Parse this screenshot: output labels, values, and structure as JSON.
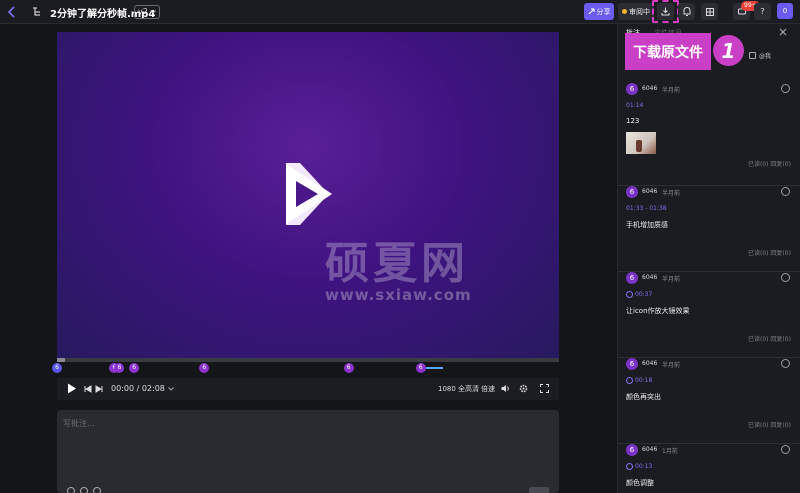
{
  "header": {
    "file_title": "2分钟了解分秒帧.mp4",
    "version": "v2",
    "share_label": "分享",
    "review_label": "审阅中",
    "notification_badge": "99+",
    "help_label": "?",
    "user_initial": "0"
  },
  "player": {
    "watermark_big": "硕夏网",
    "watermark_small": "www.sxiaw.com",
    "time_display": "00:00 / 02:08",
    "quality_label": "1080 全高清",
    "speed_label": "倍速",
    "progress_fraction": 0.015,
    "markers": [
      {
        "label": "6",
        "pos": 0.0,
        "kind": "start"
      },
      {
        "label": "6",
        "pos": 0.113
      },
      {
        "label": "6",
        "pos": 0.123
      },
      {
        "label": "6",
        "pos": 0.152
      },
      {
        "label": "6",
        "pos": 0.29
      },
      {
        "label": "6",
        "pos": 0.574
      },
      {
        "label": "6",
        "pos": 0.716,
        "range_end": 0.75
      }
    ]
  },
  "comment_input": {
    "placeholder": "写批注..."
  },
  "panel": {
    "tab_comments": "批注",
    "tab_file": "文件信息",
    "only_me_label": "@我",
    "callout_text": "下载原文件",
    "callout_number": "1",
    "comments": [
      {
        "avatar": "6",
        "user": "6046",
        "ago": "半月前",
        "timestamp": "01:14",
        "text": "123",
        "has_image": true,
        "read_label": "已读(0)",
        "reply_label": "回复(0)"
      },
      {
        "avatar": "6",
        "user": "6046",
        "ago": "半月前",
        "timestamp": "01:33 - 01:38",
        "text": "手机增加质感",
        "has_image": false,
        "read_label": "已读(0)",
        "reply_label": "回复(0)"
      },
      {
        "avatar": "6",
        "user": "6046",
        "ago": "半月前",
        "timestamp": "00:37",
        "text": "让icon作放大镜效果",
        "has_image": false,
        "clock": true,
        "read_label": "已读(0)",
        "reply_label": "回复(0)"
      },
      {
        "avatar": "6",
        "user": "6046",
        "ago": "半月前",
        "timestamp": "00:18",
        "text": "颜色再突出",
        "has_image": false,
        "clock": true,
        "read_label": "已读(0)",
        "reply_label": "回复(0)"
      },
      {
        "avatar": "6",
        "user": "6046",
        "ago": "1月前",
        "timestamp": "00:13",
        "text": "颜色调整",
        "has_image": false,
        "clock": true,
        "read_label": "",
        "reply_label": ""
      }
    ]
  },
  "colors": {
    "accent": "#6a5cf0",
    "callout": "#c93fc6",
    "marker": "#8c33cf"
  }
}
